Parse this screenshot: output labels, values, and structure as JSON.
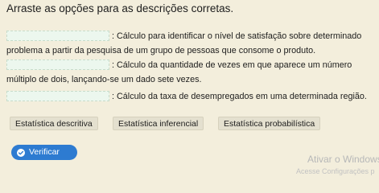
{
  "title": "Arraste as opções para as descrições corretas.",
  "items": [
    {
      "description_line1": ": Cálculo para identificar o nível de satisfação sobre determinado",
      "description_line2": "problema a partir da pesquisa de um grupo de pessoas que consome o produto."
    },
    {
      "description_line1": ": Cálculo da quantidade de vezes em que aparece um número",
      "description_line2": "múltiplo de dois, lançando-se um dado sete vezes."
    },
    {
      "description_line1": ": Cálculo da taxa de desempregados em uma determinada região."
    }
  ],
  "options": [
    "Estatística descritiva",
    "Estatística inferencial",
    "Estatística probabilística"
  ],
  "verify_label": "Verificar",
  "watermark": {
    "line1": "Ativar o Windows",
    "line2": "Acesse Configurações p"
  },
  "colors": {
    "background": "#f3eedc",
    "drop_zone": "#ecf7ee",
    "chip": "#e4e0cf",
    "verify_button": "#2d7bd1"
  }
}
